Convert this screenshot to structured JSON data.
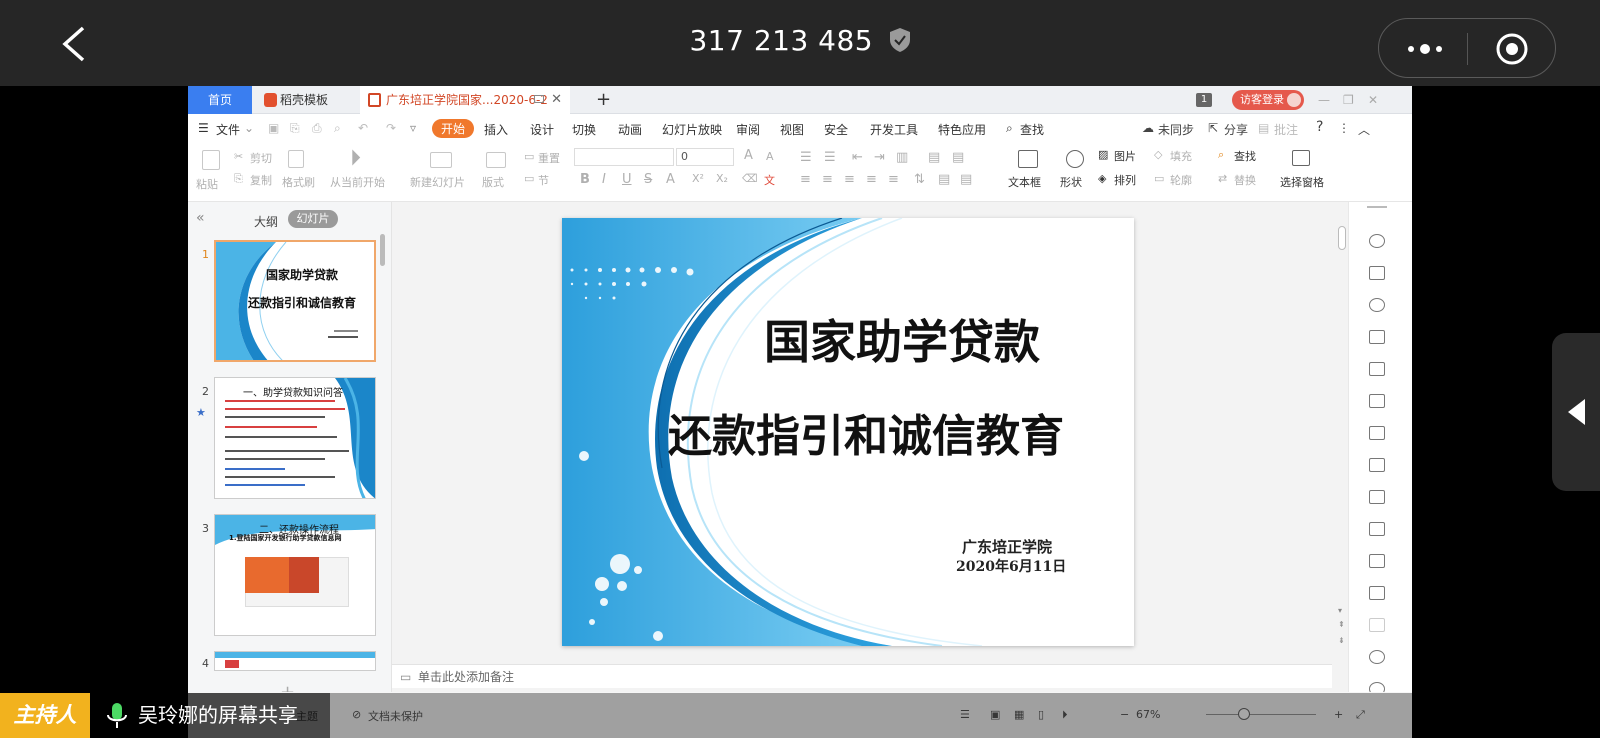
{
  "meeting": {
    "id": "317 213 485",
    "host_badge": "主持人",
    "share_label": "吴玲娜的屏幕共享"
  },
  "tabs": {
    "home": "首页",
    "template": "稻壳模板",
    "document": "广东培正学院国家...2020-6-2",
    "plus": "+"
  },
  "titlebar": {
    "page_count": "1",
    "visitor_login": "访客登录"
  },
  "menu": {
    "file": "文件",
    "start": "开始",
    "insert": "插入",
    "design": "设计",
    "transition": "切换",
    "animation": "动画",
    "slideshow": "幻灯片放映",
    "review": "审阅",
    "view": "视图",
    "security": "安全",
    "devtools": "开发工具",
    "features": "特色应用",
    "search": "查找",
    "unsync": "未同步",
    "share": "分享",
    "comment": "批注",
    "help": "?"
  },
  "ribbon": {
    "paste": "粘贴",
    "cut": "剪切",
    "copy": "复制",
    "format_painter": "格式刷",
    "from_current": "从当前开始",
    "new_slide": "新建幻灯片",
    "layout": "版式",
    "reset": "重置",
    "section": "节",
    "font_size": "0",
    "textbox": "文本框",
    "shape": "形状",
    "picture": "图片",
    "arrange": "排列",
    "fill": "填充",
    "outline": "轮廓",
    "find": "查找",
    "replace": "替换",
    "selection_pane": "选择窗格"
  },
  "left_panel": {
    "outline_tab": "大纲",
    "slides_tab": "幻灯片",
    "thumbs": [
      {
        "num": "1",
        "title1": "国家助学贷款",
        "title2": "还款指引和诚信教育"
      },
      {
        "num": "2",
        "title1": "一、助学贷款知识问答"
      },
      {
        "num": "3",
        "title1": "二、还款操作流程",
        "sub": "1.登陆国家开发银行助学贷款信息网"
      },
      {
        "num": "4"
      }
    ]
  },
  "slide": {
    "title1": "国家助学贷款",
    "title2": "还款指引和诚信教育",
    "org": "广东培正学院",
    "date": "2020年6月11日"
  },
  "notes_placeholder": "单击此处添加备注",
  "status": {
    "theme": "主题",
    "protect": "文档未保护",
    "zoom": "67%"
  },
  "colors": {
    "accent_orange": "#f0782c",
    "tab_blue": "#3a7ef0",
    "host_yellow": "#f2b21e",
    "slide_blue": "#29a3e0"
  }
}
